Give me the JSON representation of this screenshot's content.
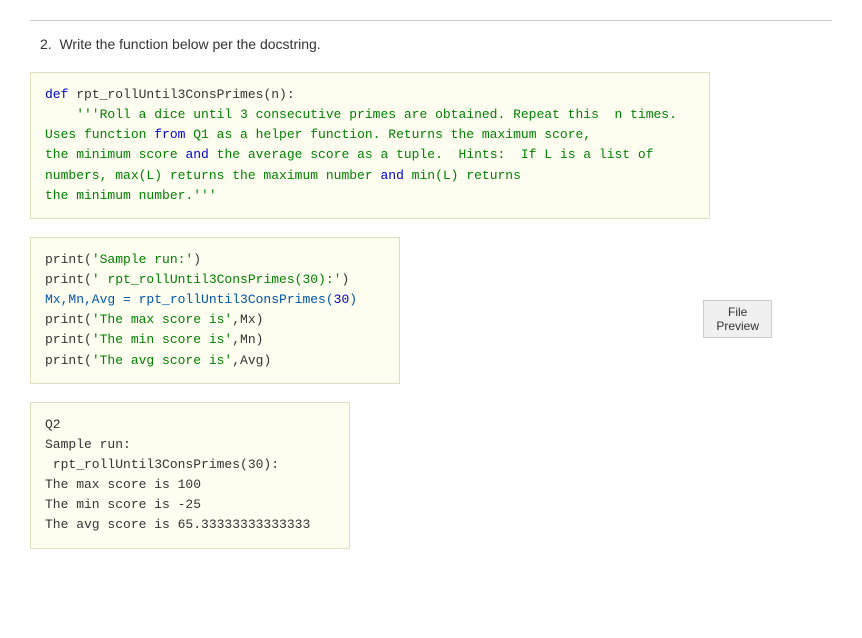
{
  "question": {
    "number": "2.",
    "text": "Write the function below per the docstring."
  },
  "docstring_block": {
    "lines": [
      {
        "type": "code",
        "content": "def rpt_rollUntil3ConsPrimes(n):"
      },
      {
        "type": "string",
        "content": "    '''Roll a dice until 3 consecutive primes are obtained. Repeat this  n times."
      },
      {
        "type": "string",
        "content": "Uses function from Q1 as a helper function. Returns the maximum score,"
      },
      {
        "type": "string",
        "content": "the minimum score and the average score as a tuple.  Hints:  If L is a list of"
      },
      {
        "type": "string",
        "content": "numbers, max(L) returns the maximum number and min(L) returns"
      },
      {
        "type": "string",
        "content": "the minimum number.'''"
      }
    ]
  },
  "sample_run_block": {
    "lines": [
      "print('Sample run:')",
      "print(' rpt_rollUntil3ConsPrimes(30):')",
      "Mx,Mn,Avg = rpt_rollUntil3ConsPrimes(30)",
      "print('The max score is',Mx)",
      "print('The min score is',Mn)",
      "print('The avg score is',Avg)"
    ]
  },
  "output_block": {
    "label": "Q2",
    "lines": [
      "Sample run:",
      " rpt_rollUntil3ConsPrimes(30):",
      "The max score is 100",
      "The min score is -25",
      "The avg score is 65.33333333333333"
    ]
  },
  "file_preview_button": {
    "label": "File Preview"
  }
}
